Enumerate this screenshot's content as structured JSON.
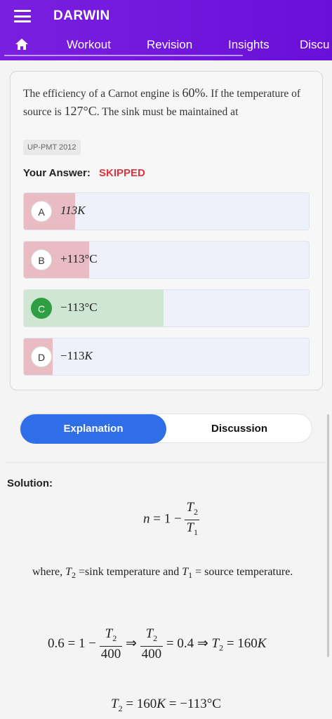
{
  "header": {
    "title": "DARWIN",
    "tabs": [
      "Workout",
      "Revision",
      "Insights",
      "Discu"
    ]
  },
  "question": {
    "text_part1": "The efficiency of a Carnot engine is ",
    "efficiency": "60%",
    "text_part2": ". If the temperature of source is ",
    "source_temp": "127°C",
    "text_part3": ". The sink must be maintained at",
    "tag": "UP-PMT 2012",
    "your_answer_label": "Your Answer:",
    "your_answer_value": "SKIPPED"
  },
  "options": [
    {
      "letter": "A",
      "text": "113K",
      "fill_fraction": 0.18,
      "status": "wrong"
    },
    {
      "letter": "B",
      "text": "+113°C",
      "fill_fraction": 0.23,
      "status": "wrong"
    },
    {
      "letter": "C",
      "text": "−113°C",
      "fill_fraction": 0.49,
      "status": "correct"
    },
    {
      "letter": "D",
      "text": "−113K",
      "fill_fraction": 0.1,
      "status": "wrong"
    }
  ],
  "segment": {
    "active": "Explanation",
    "inactive": "Discussion"
  },
  "solution": {
    "label": "Solution:",
    "eq1_lhs": "n = 1 −",
    "eq1_num": "T2",
    "eq1_den": "T1",
    "where_text": "where, T2 =sink temperature and T1 = source temperature.",
    "eq2_a": "0.6 = 1 −",
    "eq2_num1": "T2",
    "eq2_den1": "400",
    "eq2_b": "⇒",
    "eq2_num2": "T2",
    "eq2_den2": "400",
    "eq2_c": "= 0.4 ⇒ T2 = 160K",
    "eq3": "T2 = 160K = −113°C"
  },
  "colors": {
    "header": "#7a1fe0",
    "accent": "#2f6ee6",
    "wrong_fill": "#e8bcc2",
    "correct_fill": "#cfe6d2",
    "correct_badge": "#2ea043",
    "skipped": "#e0343f"
  }
}
